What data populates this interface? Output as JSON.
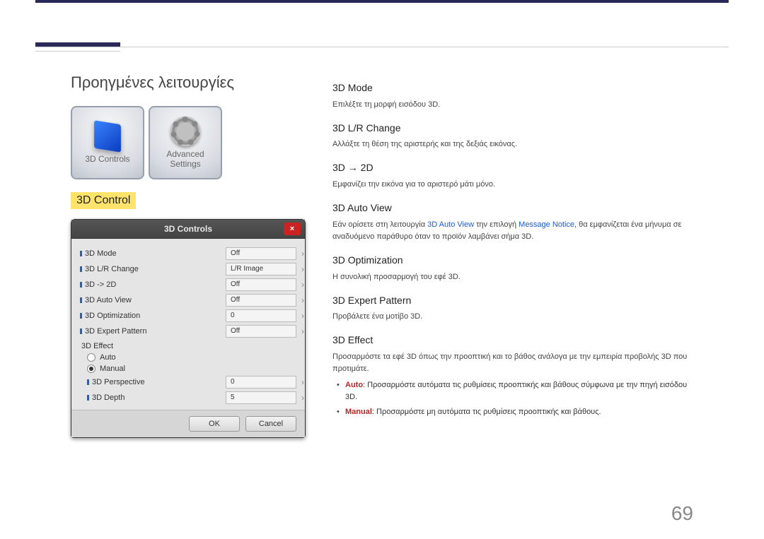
{
  "page_title": "Προηγμένες λειτουργίες",
  "icon_tiles": {
    "left": {
      "label": "3D Controls",
      "icon_name": "cube-icon"
    },
    "right": {
      "label": "Advanced Settings",
      "icon_name": "gear-icon"
    }
  },
  "sub_heading": "3D Control",
  "panel": {
    "title": "3D Controls",
    "close_char": "×",
    "rows": [
      {
        "label": "3D Mode",
        "value": "Off"
      },
      {
        "label": "3D L/R Change",
        "value": "L/R Image"
      },
      {
        "label": "3D -> 2D",
        "value": "Off"
      },
      {
        "label": "3D Auto View",
        "value": "Off"
      },
      {
        "label": "3D Optimization",
        "value": "0"
      },
      {
        "label": "3D Expert Pattern",
        "value": "Off"
      }
    ],
    "effect_section": "3D Effect",
    "radio_auto": "Auto",
    "radio_manual": "Manual",
    "manual_rows": [
      {
        "label": "3D Perspective",
        "value": "0"
      },
      {
        "label": "3D Depth",
        "value": "5"
      }
    ],
    "ok": "OK",
    "cancel": "Cancel"
  },
  "right": {
    "mode": {
      "h": "3D Mode",
      "d": "Επιλέξτε τη μορφή εισόδου 3D."
    },
    "lr": {
      "h": "3D L/R Change",
      "d": "Αλλάξτε τη θέση της αριστερής και της δεξιάς εικόνας."
    },
    "to2d": {
      "h": "3D → 2D",
      "d": "Εμφανίζει την εικόνα για το αριστερό μάτι μόνο."
    },
    "auto": {
      "h": "3D Auto View",
      "d_pre": "Εάν ορίσετε στη λειτουργία ",
      "term1": "3D Auto View",
      "d_mid": " την επιλογή ",
      "term2": "Message Notice",
      "d_post": ", θα εμφανίζεται ένα μήνυμα σε αναδυόμενο παράθυρο όταν το προϊόν λαμβάνει σήμα 3D."
    },
    "opt": {
      "h": "3D Optimization",
      "d": "Η συνολική προσαρμογή του εφέ 3D."
    },
    "expert": {
      "h": "3D Expert Pattern",
      "d": "Προβάλετε ένα μοτίβο 3D."
    },
    "effect": {
      "h": "3D Effect",
      "d": "Προσαρμόστε τα εφέ 3D όπως την προοπτική και το βάθος ανάλογα με την εμπειρία προβολής 3D που προτιμάτε.",
      "li1_term": "Auto",
      "li1_rest": ": Προσαρμόστε αυτόματα τις ρυθμίσεις προοπτικής και βάθους σύμφωνα με την πηγή εισόδου 3D.",
      "li2_term": "Manual",
      "li2_rest": ": Προσαρμόστε μη αυτόματα τις ρυθμίσεις προοπτικής και βάθους."
    }
  },
  "page_number": "69"
}
